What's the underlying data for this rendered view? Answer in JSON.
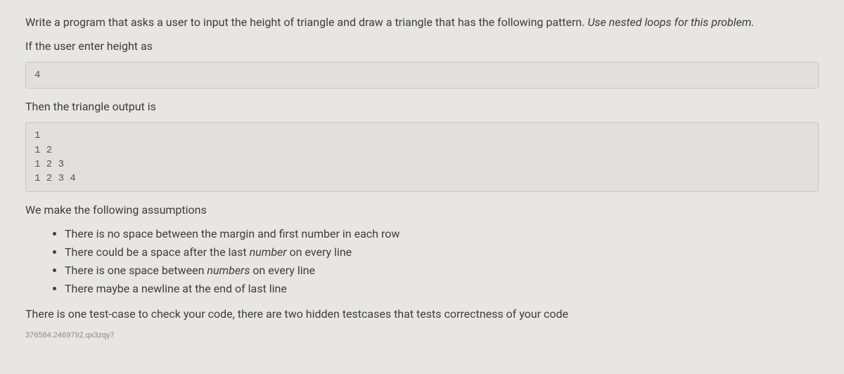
{
  "intro": {
    "part1": "Write a program that asks a user to input the height of triangle and draw a triangle that has the following pattern. ",
    "italic": "Use nested loops for this problem."
  },
  "prompt_enter": "If the user enter height as",
  "input_value": "4",
  "output_label": "Then the triangle output is",
  "triangle_output": "1\n1 2\n1 2 3\n1 2 3 4",
  "assumptions_label": "We make the following assumptions",
  "assumptions": [
    {
      "pre": "There is no space between the margin and first number in each row",
      "italic": "",
      "post": ""
    },
    {
      "pre": "There could be a space after the last ",
      "italic": "number",
      "post": " on every line"
    },
    {
      "pre": "There is one space between ",
      "italic": "numbers",
      "post": " on every line"
    },
    {
      "pre": "There maybe a newline at the end of last line",
      "italic": "",
      "post": ""
    }
  ],
  "testcase_note": "There is one test-case to check your code, there are two hidden testcases that tests correctness of your code",
  "footer_code": "376584.2469792.qx3zqy7"
}
